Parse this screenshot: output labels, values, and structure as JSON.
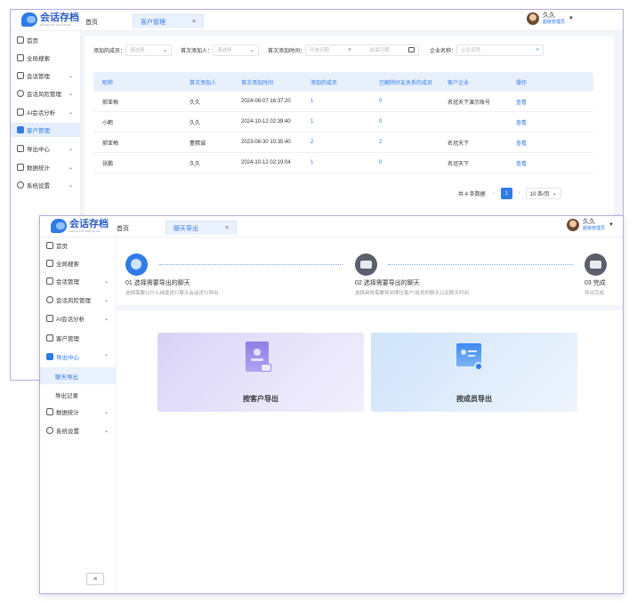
{
  "brand": {
    "name": "会话存档",
    "sub": "SESSION ARCHIVE"
  },
  "user": {
    "name": "久久",
    "role": "超级管理员",
    "caret": "▼"
  },
  "window1": {
    "tabs": {
      "home": "首页",
      "active": "客户管理",
      "close": "×"
    },
    "sidebar": [
      {
        "label": "首页",
        "icon": "home-icon"
      },
      {
        "label": "全局搜索",
        "icon": "search-icon"
      },
      {
        "label": "会话管理",
        "icon": "chat-icon",
        "chev": "⌄"
      },
      {
        "label": "会话风险管理",
        "icon": "shield-icon",
        "chev": "⌄"
      },
      {
        "label": "AI会话分析",
        "icon": "ai-icon",
        "chev": "⌄"
      },
      {
        "label": "客户管理",
        "icon": "customer-icon",
        "active": true
      },
      {
        "label": "导出中心",
        "icon": "export-icon",
        "chev": "⌄"
      },
      {
        "label": "数据统计",
        "icon": "chart-icon",
        "chev": "⌄"
      },
      {
        "label": "系统设置",
        "icon": "settings-icon",
        "chev": "⌄"
      }
    ],
    "filters": {
      "member_label": "添加的成员：",
      "member_placeholder": "请选择",
      "adder_label": "首次添加人：",
      "adder_placeholder": "请选择",
      "time_label": "首次添加时间：",
      "start_placeholder": "开始日期",
      "range_sep": "≡",
      "end_placeholder": "结束日期",
      "company_label": "企业名称：",
      "company_placeholder": "企业名称"
    },
    "table": {
      "headers": [
        "昵称",
        "首次添加人",
        "首次添加时间",
        "添加的成员",
        "已解除好友关系的成员",
        "客户企业",
        "操作"
      ],
      "rows": [
        [
          "郝亚梅",
          "久久",
          "2024-08-07 16:37:20",
          "1",
          "0",
          "名冠天下演示账号",
          "查看"
        ],
        [
          "小鹤",
          "久久",
          "2024-10-12 02:39:40",
          "1",
          "0",
          "",
          "查看"
        ],
        [
          "郝亚梅",
          "董精诚",
          "2023-08-30 10:35:40",
          "2",
          "2",
          "名冠天下",
          "查看"
        ],
        [
          "张鹏",
          "久久",
          "2024-10-12 02:19:04",
          "1",
          "0",
          "名冠天下",
          "查看"
        ]
      ]
    },
    "pager": {
      "total": "共 4 条数据",
      "prev": "‹",
      "page": "1",
      "next": "›",
      "size": "10 条/页",
      "size_caret": "⌄"
    }
  },
  "window2": {
    "tabs": {
      "home": "首页",
      "active": "聊天导出",
      "close": "×"
    },
    "sidebar": [
      {
        "label": "首页",
        "icon": "home-icon"
      },
      {
        "label": "全局搜索",
        "icon": "search-icon"
      },
      {
        "label": "会话管理",
        "icon": "chat-icon",
        "chev": "⌄"
      },
      {
        "label": "会话风险管理",
        "icon": "shield-icon",
        "chev": "⌄"
      },
      {
        "label": "AI会话分析",
        "icon": "ai-icon",
        "chev": "⌄"
      },
      {
        "label": "客户管理",
        "icon": "customer-icon"
      },
      {
        "label": "导出中心",
        "icon": "export-icon",
        "chev": "⌃",
        "open": true
      },
      {
        "label": "聊天导出",
        "sub": true,
        "active": true
      },
      {
        "label": "导出记录",
        "sub": true
      },
      {
        "label": "数据统计",
        "icon": "chart-icon",
        "chev": "⌄"
      },
      {
        "label": "系统设置",
        "icon": "settings-icon",
        "chev": "⌄"
      }
    ],
    "collapse": "≡",
    "steps": [
      {
        "title": "01 选择需要导出的聊天",
        "desc": "选择需要以什么纬度进行聊天会话进行导出"
      },
      {
        "title": "02 选择需要导出的聊天",
        "desc": "选择具体需要导出哪位客户/成员的聊天以及聊天时间"
      },
      {
        "title": "03 完成",
        "desc": "导出完成"
      }
    ],
    "cards": [
      {
        "title": "按客户导出"
      },
      {
        "title": "按成员导出"
      }
    ]
  },
  "colors": {
    "accent": "#2f7be8",
    "border": "#b7a9e3",
    "bg": "#f3f5f9"
  }
}
